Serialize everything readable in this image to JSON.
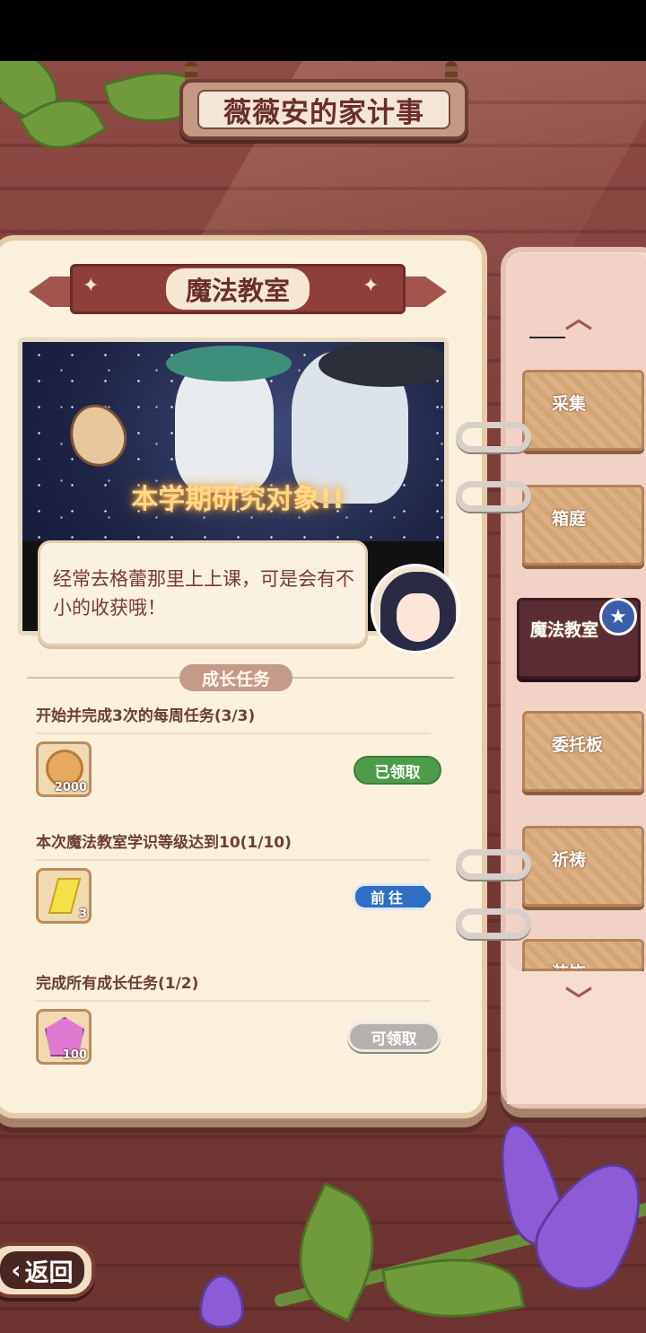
{
  "header": {
    "title": "薇薇安的家计事"
  },
  "section": {
    "title": "魔法教室"
  },
  "art": {
    "caption": "本学期研究对象!!"
  },
  "dialog": {
    "text": "经常去格蕾那里上上课，可是会有不小的收获哦！"
  },
  "tasks": {
    "header": "成长任务",
    "items": [
      {
        "title": "开始并完成3次的每周任务(3/3)",
        "reward_qty": "2000",
        "reward_icon": "coin-icon",
        "button": "已领取",
        "status": "claimed"
      },
      {
        "title": "本次魔法教室学识等级达到10(1/10)",
        "reward_qty": "3",
        "reward_icon": "crystal-shard-icon",
        "button": "前往",
        "status": "go"
      },
      {
        "title": "完成所有成长任务(1/2)",
        "reward_qty": "100",
        "reward_icon": "gem-icon",
        "button": "可领取",
        "status": "disabled"
      }
    ]
  },
  "tabs": [
    {
      "label": "采集"
    },
    {
      "label": "箱庭"
    },
    {
      "label": "魔法教室"
    },
    {
      "label": "委托板"
    },
    {
      "label": "祈祷"
    },
    {
      "label": "装饰"
    }
  ],
  "nav": {
    "back": "返回"
  },
  "colors": {
    "claimed_button": "#4c9c4a",
    "go_button": "#2f6fc2",
    "disabled_button": "#b7b1ad",
    "active_tab": "#5a2d35",
    "tab": "#dcb084"
  }
}
